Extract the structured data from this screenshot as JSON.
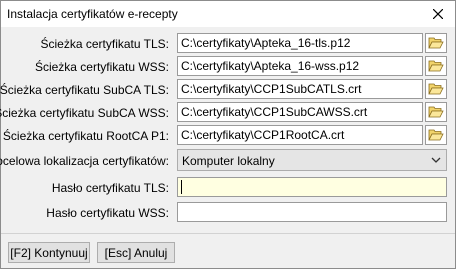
{
  "window": {
    "title": "Instalacja certyfikatów e-recepty"
  },
  "rows": {
    "tls_path": {
      "label": "Ścieżka certyfikatu TLS:",
      "value": "C:\\certyfikaty\\Apteka_16-tls.p12"
    },
    "wss_path": {
      "label": "Ścieżka certyfikatu WSS:",
      "value": "C:\\certyfikaty\\Apteka_16-wss.p12"
    },
    "subca_tls_path": {
      "label": "Ścieżka certyfikatu SubCA TLS:",
      "value": "C:\\certyfikaty\\CCP1SubCATLS.crt"
    },
    "subca_wss_path": {
      "label": "Ścieżka certyfikatu SubCA WSS:",
      "value": "C:\\certyfikaty\\CCP1SubCAWSS.crt"
    },
    "rootca_path": {
      "label": "Ścieżka certyfikatu RootCA P1:",
      "value": "C:\\certyfikaty\\CCP1RootCA.crt"
    },
    "location": {
      "label": "Docelowa lokalizacja certyfikatów:",
      "value": "Komputer lokalny"
    },
    "tls_password": {
      "label": "Hasło certyfikatu TLS:",
      "value": ""
    },
    "wss_password": {
      "label": "Hasło certyfikatu WSS:",
      "value": ""
    }
  },
  "buttons": {
    "continue_label": "[F2] Kontynuuj",
    "cancel_label": "[Esc] Anuluj"
  },
  "icons": {
    "close": "close-icon",
    "folder": "folder-open-icon",
    "dropdown": "chevron-down-icon"
  }
}
